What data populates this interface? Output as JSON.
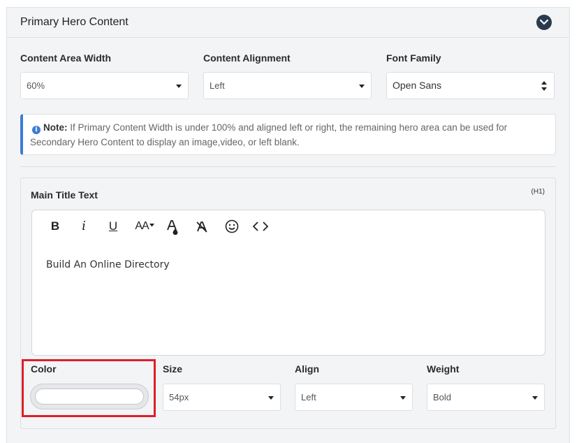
{
  "panel": {
    "title": "Primary Hero Content",
    "collapse_icon": "chevron-down-icon"
  },
  "top_fields": {
    "content_area_width": {
      "label": "Content Area Width",
      "value": "60%"
    },
    "content_alignment": {
      "label": "Content Alignment",
      "value": "Left"
    },
    "font_family": {
      "label": "Font Family",
      "value": "Open Sans"
    }
  },
  "note": {
    "bold": "Note:",
    "text": " If Primary Content Width is under 100% and aligned left or right, the remaining hero area can be used for Secondary Hero Content to display an image,video, or left blank."
  },
  "title_section": {
    "label": "Main Title Text",
    "tag": "(H1)",
    "toolbar": {
      "bold": "B",
      "italic": "i",
      "underline": "U",
      "font_size": "AA",
      "code": "<>"
    },
    "content": "Build An Online Directory"
  },
  "style_fields": {
    "color": {
      "label": "Color",
      "value": ""
    },
    "size": {
      "label": "Size",
      "value": "54px"
    },
    "align": {
      "label": "Align",
      "value": "Left"
    },
    "weight": {
      "label": "Weight",
      "value": "Bold"
    }
  },
  "colors": {
    "accent_blue": "#3f7bd6",
    "highlight_red": "#dd1f2a",
    "header_button": "#2a3a4e"
  }
}
